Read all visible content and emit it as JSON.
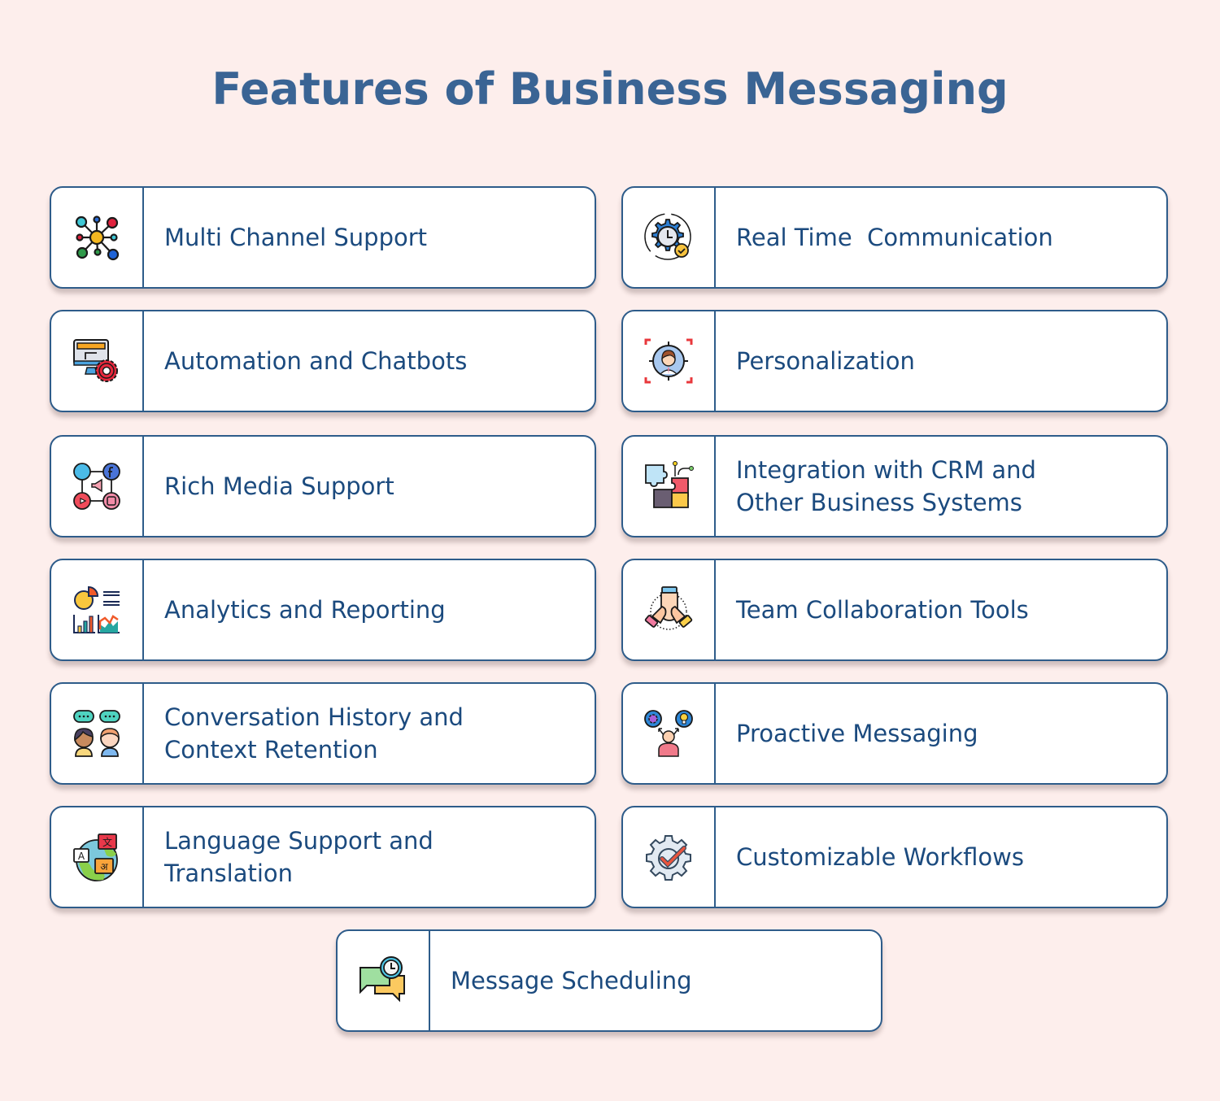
{
  "page": {
    "title": "Features of Business Messaging",
    "colors": {
      "background": "#fdeeec",
      "title": "#3a6494",
      "card_border": "#2e5c8a",
      "label_text": "#1b4a7e"
    }
  },
  "features": [
    {
      "label": "Multi Channel Support",
      "icon": "network-nodes-icon"
    },
    {
      "label": "Real Time  Communication",
      "icon": "gear-clock-icon"
    },
    {
      "label": "Automation and Chatbots",
      "icon": "monitor-gear-icon"
    },
    {
      "label": "Personalization",
      "icon": "target-person-icon"
    },
    {
      "label": "Rich Media Support",
      "icon": "social-media-icon"
    },
    {
      "label": "Integration with CRM and\nOther Business Systems",
      "icon": "puzzle-icon"
    },
    {
      "label": "Analytics and Reporting",
      "icon": "charts-icon"
    },
    {
      "label": "Team Collaboration Tools",
      "icon": "stacked-hands-icon"
    },
    {
      "label": "Conversation History and\nContext Retention",
      "icon": "people-chat-icon"
    },
    {
      "label": "Proactive Messaging",
      "icon": "person-ideas-icon"
    },
    {
      "label": "Language Support and\nTranslation",
      "icon": "globe-translate-icon"
    },
    {
      "label": "Customizable Workflows",
      "icon": "gear-check-icon"
    },
    {
      "label": "Message Scheduling",
      "icon": "chat-clock-icon"
    }
  ]
}
